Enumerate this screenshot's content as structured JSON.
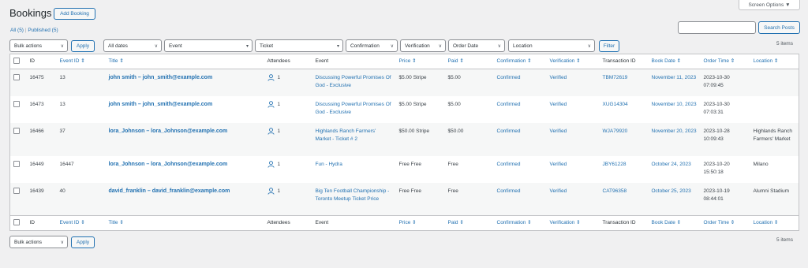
{
  "page": {
    "title": "Bookings",
    "add_button": "Add Booking",
    "screen_options": "Screen Options ▼"
  },
  "views": {
    "all": "All (5)",
    "sep": "|",
    "published": "Published (5)"
  },
  "search": {
    "placeholder": "",
    "button": "Search Posts"
  },
  "items_count": "5 items",
  "filters": {
    "bulk_actions": "Bulk actions",
    "apply": "Apply",
    "dates": "All dates",
    "event": "Event",
    "ticket": "Ticket",
    "confirmation": "Confirmation",
    "verification": "Verification",
    "order_date": "Order Date",
    "location": "Location",
    "filter_button": "Filter"
  },
  "columns": {
    "id": "ID",
    "event_id": "Event ID ⇕",
    "title": "Title ⇕",
    "attendees": "Attendees",
    "event": "Event",
    "price": "Price ⇕",
    "paid": "Paid ⇕",
    "confirmation": "Confirmation ⇕",
    "verification": "Verification ⇕",
    "transaction_id": "Transaction ID",
    "book_date": "Book Date ⇕",
    "order_time": "Order Time ⇕",
    "location": "Location ⇕"
  },
  "rows": [
    {
      "id": "16475",
      "event_id": "13",
      "title": "john smith – john_smith@example.com",
      "attendees": "1",
      "event": "Discussing Powerful Promises Of God - Exclusive",
      "price": "$5.00 Stripe",
      "paid": "$5.00",
      "confirmation": "Confirmed",
      "verification": "Verified",
      "transaction_id": "TBM72619",
      "book_date": "November 11, 2023",
      "order_time": "2023-10-30 07:09:45",
      "location": ""
    },
    {
      "id": "16473",
      "event_id": "13",
      "title": "john smith – john_smith@example.com",
      "attendees": "1",
      "event": "Discussing Powerful Promises Of God - Exclusive",
      "price": "$5.00 Stripe",
      "paid": "$5.00",
      "confirmation": "Confirmed",
      "verification": "Verified",
      "transaction_id": "XUG14304",
      "book_date": "November 10, 2023",
      "order_time": "2023-10-30 07:03:31",
      "location": ""
    },
    {
      "id": "16466",
      "event_id": "37",
      "title": "lora_Johnson – lora_Johnson@example.com",
      "attendees": "1",
      "event": "Highlands Ranch Farmers' Market - Ticket # 2",
      "price": "$50.00 Stripe",
      "paid": "$50.00",
      "confirmation": "Confirmed",
      "verification": "Verified",
      "transaction_id": "WJA79920",
      "book_date": "November 20, 2023",
      "order_time": "2023-10-28 10:09:43",
      "location": "Highlands Ranch Farmers' Market"
    },
    {
      "id": "16449",
      "event_id": "16447",
      "title": "lora_Johnson – lora_Johnson@example.com",
      "attendees": "1",
      "event": "Fun - Hydra",
      "price": "Free Free",
      "paid": "Free",
      "confirmation": "Confirmed",
      "verification": "Verified",
      "transaction_id": "JBY61228",
      "book_date": "October 24, 2023",
      "order_time": "2023-10-20 15:50:18",
      "location": "Milano"
    },
    {
      "id": "16439",
      "event_id": "40",
      "title": "david_franklin – david_franklin@example.com",
      "attendees": "1",
      "event": "Big Ten Football Championship - Toronto Meetup Ticket Price",
      "price": "Free Free",
      "paid": "Free",
      "confirmation": "Confirmed",
      "verification": "Verified",
      "transaction_id": "CAT96358",
      "book_date": "October 25, 2023",
      "order_time": "2023-10-19 08:44:01",
      "location": "Alumni Stadium"
    }
  ],
  "bottom": {
    "bulk_actions": "Bulk actions",
    "apply": "Apply",
    "items_count": "5 items"
  },
  "icons": {
    "dropdown": "chevron-down-icon",
    "attendee": "user-icon"
  },
  "colors": {
    "accent": "#2271b1",
    "background": "#f0f0f1"
  }
}
